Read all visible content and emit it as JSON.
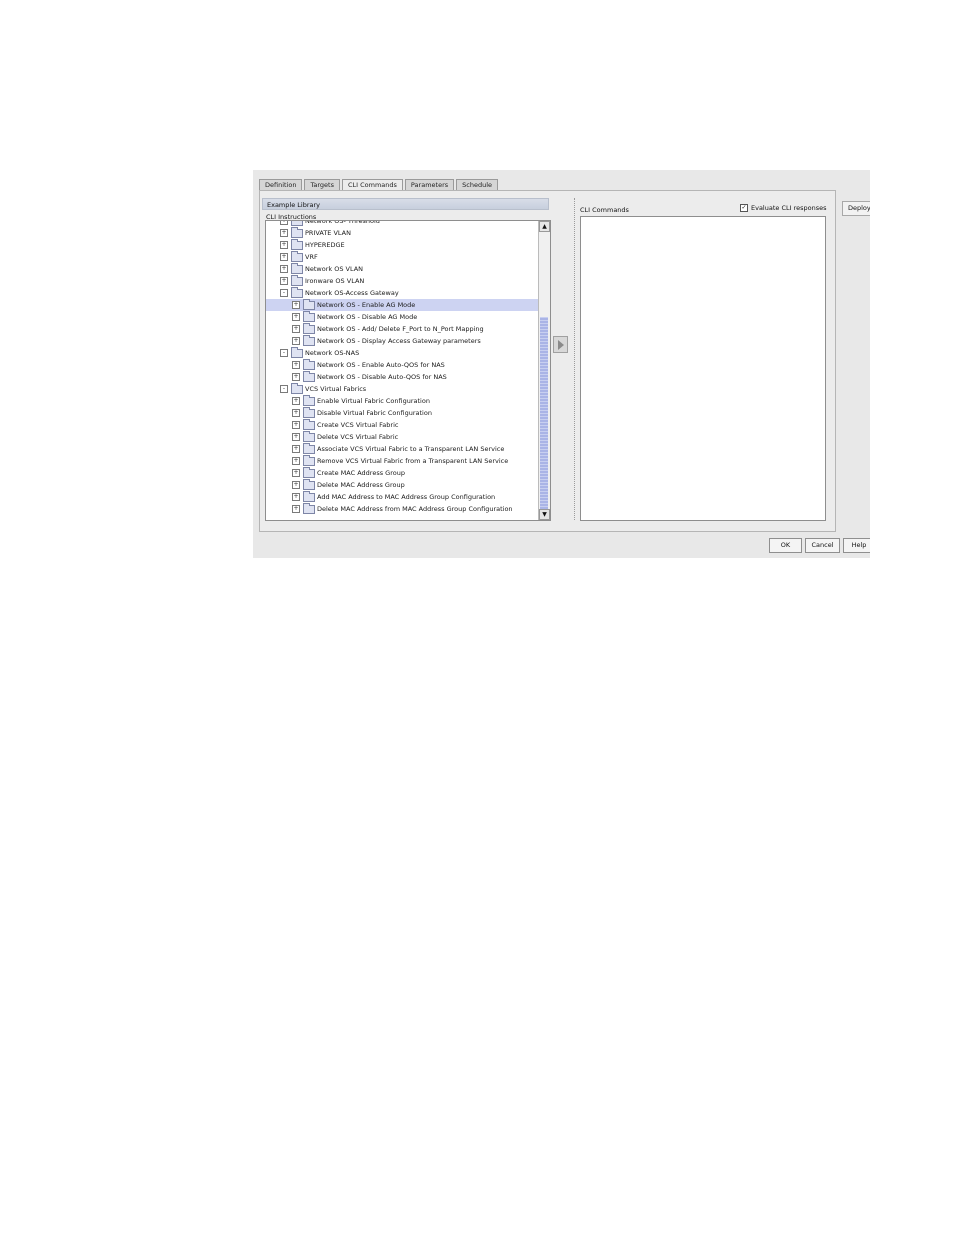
{
  "tabs": [
    "Definition",
    "Targets",
    "CLI Commands",
    "Parameters",
    "Schedule"
  ],
  "active_tab": "CLI Commands",
  "library": {
    "header": "Example Library",
    "section_label": "CLI Instructions",
    "tree": [
      {
        "label": "Network OS- Threshold",
        "level": 1,
        "expander": "+"
      },
      {
        "label": "PRIVATE VLAN",
        "level": 1,
        "expander": "+"
      },
      {
        "label": "HYPEREDGE",
        "level": 1,
        "expander": "+"
      },
      {
        "label": "VRF",
        "level": 1,
        "expander": "+"
      },
      {
        "label": "Network OS VLAN",
        "level": 1,
        "expander": "+"
      },
      {
        "label": "Ironware OS VLAN",
        "level": 1,
        "expander": "+"
      },
      {
        "label": "Network OS-Access Gateway",
        "level": 1,
        "expander": "-"
      },
      {
        "label": "Network OS - Enable AG Mode",
        "level": 2,
        "expander": "+",
        "selected": true
      },
      {
        "label": "Network OS - Disable AG Mode",
        "level": 2,
        "expander": "+"
      },
      {
        "label": "Network OS - Add/ Delete F_Port to N_Port Mapping",
        "level": 2,
        "expander": "+"
      },
      {
        "label": "Network OS - Display Access Gateway parameters",
        "level": 2,
        "expander": "+"
      },
      {
        "label": "Network OS-NAS",
        "level": 1,
        "expander": "-"
      },
      {
        "label": "Network OS - Enable Auto-QOS for NAS",
        "level": 2,
        "expander": "+"
      },
      {
        "label": "Network OS - Disable Auto-QOS for NAS",
        "level": 2,
        "expander": "+"
      },
      {
        "label": "VCS Virtual Fabrics",
        "level": 1,
        "expander": "-"
      },
      {
        "label": "Enable Virtual Fabric Configuration",
        "level": 2,
        "expander": "+"
      },
      {
        "label": "Disable Virtual Fabric Configuration",
        "level": 2,
        "expander": "+"
      },
      {
        "label": "Create VCS Virtual Fabric",
        "level": 2,
        "expander": "+"
      },
      {
        "label": "Delete VCS Virtual Fabric",
        "level": 2,
        "expander": "+"
      },
      {
        "label": "Associate VCS Virtual Fabric to a Transparent LAN Service",
        "level": 2,
        "expander": "+"
      },
      {
        "label": "Remove VCS Virtual Fabric from a Transparent LAN Service",
        "level": 2,
        "expander": "+"
      },
      {
        "label": "Create MAC Address Group",
        "level": 2,
        "expander": "+"
      },
      {
        "label": "Delete MAC Address Group",
        "level": 2,
        "expander": "+"
      },
      {
        "label": "Add MAC Address to MAC Address Group Configuration",
        "level": 2,
        "expander": "+"
      },
      {
        "label": "Delete MAC Address from MAC Address Group Configuration",
        "level": 2,
        "expander": "+"
      }
    ]
  },
  "cli_commands": {
    "label": "CLI Commands",
    "evaluate_label": "Evaluate CLI responses",
    "evaluate_checked": true
  },
  "buttons": {
    "deploy": "Deploy",
    "ok": "OK",
    "cancel": "Cancel",
    "help": "Help"
  },
  "icons": {
    "scroll_up": "▲",
    "scroll_down": "▼",
    "check": "✓"
  }
}
